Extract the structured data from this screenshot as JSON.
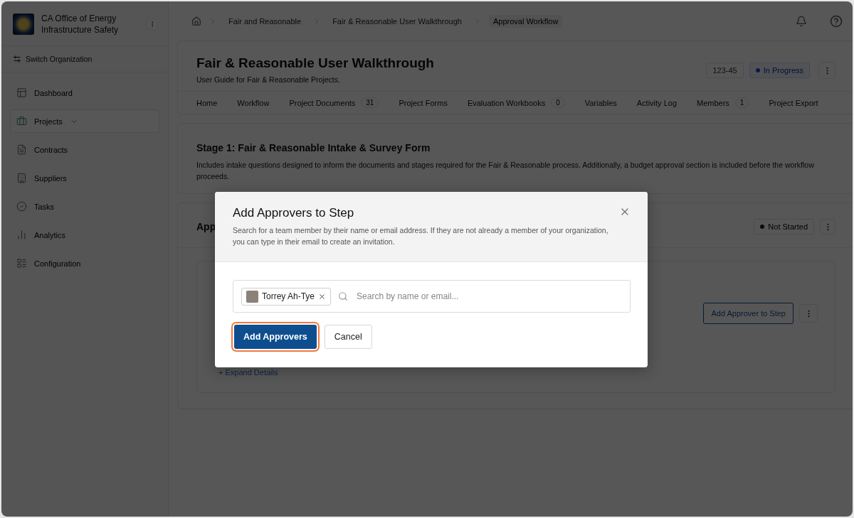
{
  "sidebar": {
    "org_name": "CA Office of Energy Infrastructure Safety",
    "switch_label": "Switch Organization",
    "items": [
      {
        "label": "Dashboard",
        "selected": false,
        "expandable": false
      },
      {
        "label": "Projects",
        "selected": true,
        "expandable": true
      },
      {
        "label": "Contracts",
        "selected": false,
        "expandable": false
      },
      {
        "label": "Suppliers",
        "selected": false,
        "expandable": false
      },
      {
        "label": "Tasks",
        "selected": false,
        "expandable": false
      },
      {
        "label": "Analytics",
        "selected": false,
        "expandable": false
      },
      {
        "label": "Configuration",
        "selected": false,
        "expandable": false
      }
    ]
  },
  "breadcrumbs": [
    "Fair and Reasonable",
    "Fair & Reasonable User Walkthrough",
    "Approval Workflow"
  ],
  "project": {
    "title": "Fair & Reasonable User Walkthrough",
    "subtitle": "User Guide for Fair & Reasonable Projects.",
    "code": "123-45",
    "status": "In Progress"
  },
  "tabs": [
    {
      "label": "Home"
    },
    {
      "label": "Workflow"
    },
    {
      "label": "Project Documents",
      "count": "31"
    },
    {
      "label": "Project Forms"
    },
    {
      "label": "Evaluation Workbooks",
      "count": "0"
    },
    {
      "label": "Variables"
    },
    {
      "label": "Activity Log"
    },
    {
      "label": "Members",
      "count": "1"
    },
    {
      "label": "Project Export"
    }
  ],
  "stage": {
    "title": "Stage 1: Fair & Reasonable Intake & Survey Form",
    "description": "Includes intake questions designed to inform the documents and stages required for the Fair & Reasonable process. Additionally, a budget approval section is included before the workflow proceeds."
  },
  "approval": {
    "title": "App",
    "status": "Not Started",
    "action": "Add Approver to Step",
    "expand_link": "+ Expand Details"
  },
  "dialog": {
    "title": "Add Approvers to Step",
    "description": "Search for a team member by their name or email address. If they are not already a member of your organization, you can type in their email to create an invitation.",
    "chips": [
      {
        "name": "Torrey Ah-Tye"
      }
    ],
    "placeholder": "Search by name or email...",
    "primary": "Add Approvers",
    "secondary": "Cancel"
  }
}
